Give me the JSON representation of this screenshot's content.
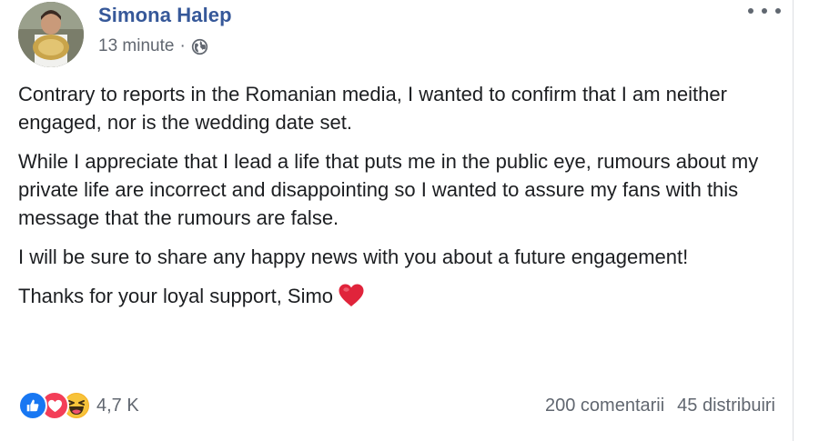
{
  "post": {
    "author": "Simona Halep",
    "time": "13 minute",
    "separator": "·",
    "audience_icon": "globe-icon",
    "menu_icon": "more-options-icon",
    "paragraphs": [
      "Contrary to reports in the Romanian media, I wanted to confirm that I am neither engaged, nor is the wedding date set.",
      "While I appreciate that I lead a life that puts me in the public eye, rumours about my private life are incorrect and disappointing so I wanted to assure my fans with this message that the rumours are false.",
      "I will be sure to share any happy news with you about a future engagement!",
      "Thanks for your loyal support, Simo"
    ],
    "closing_emoji": "red-heart-icon"
  },
  "footer": {
    "reaction_icons": [
      "like-icon",
      "love-icon",
      "haha-icon"
    ],
    "reaction_count": "4,7 K",
    "comments": "200 comentarii",
    "shares": "45 distribuiri"
  },
  "colors": {
    "author_link": "#365899",
    "secondary_text": "#616770",
    "body_text": "#1c1e21",
    "like_blue": "#1877f2",
    "love_red": "#f33e58",
    "haha_yellow": "#f7b125"
  }
}
